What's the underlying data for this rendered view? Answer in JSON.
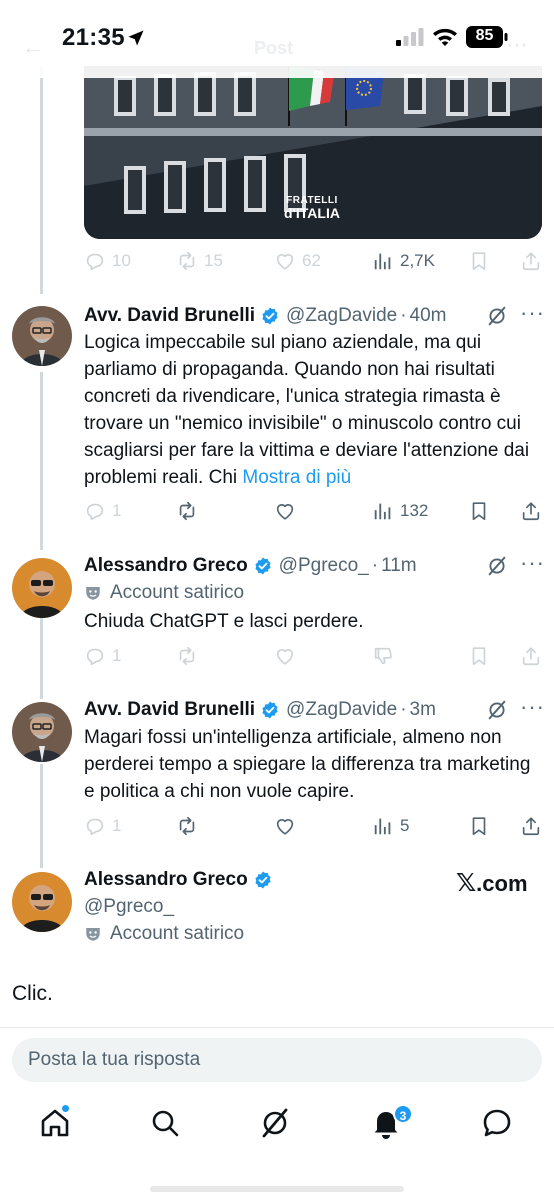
{
  "status_bar": {
    "time": "21:35",
    "battery": "85"
  },
  "header": {
    "title": "Post"
  },
  "media": {
    "logo_line1": "FRATELLI",
    "logo_line2": "d'ITALIA"
  },
  "top_stats": {
    "replies": "10",
    "reposts": "15",
    "likes": "62",
    "views": "2,7K"
  },
  "tweets": [
    {
      "name": "Avv. David Brunelli",
      "handle": "@ZagDavide",
      "sep": "·",
      "time": "40m",
      "text": "Logica impeccabile sul piano aziendale, ma qui parliamo di propaganda. Quando non hai risultati concreti da rivendicare, l'unica strategia rimasta è trovare un \"nemico invisibile\" o minuscolo contro cui scagliarsi per fare la vittima e deviare l'attenzione dai problemi reali. Chi ",
      "show_more": "Mostra di più",
      "replies": "1",
      "views": "132"
    },
    {
      "name": "Alessandro Greco",
      "handle": "@Pgreco_",
      "sep": "·",
      "time": "11m",
      "label": "Account satirico",
      "text": "Chiuda ChatGPT e lasci perdere.",
      "replies": "1"
    },
    {
      "name": "Avv. David Brunelli",
      "handle": "@ZagDavide",
      "sep": "·",
      "time": "3m",
      "text": "Magari fossi un'intelligenza artificiale, almeno non perderei tempo a spiegare la differenza tra marketing e politica a chi non vuole capire.",
      "replies": "1",
      "views": "5"
    },
    {
      "name": "Alessandro Greco",
      "handle": "@Pgreco_",
      "label": "Account satirico"
    }
  ],
  "watermark": {
    "x": "𝕏",
    "rest": ".com"
  },
  "caption": "Clic.",
  "reply": {
    "placeholder": "Posta la tua risposta"
  },
  "tabbar": {
    "notifications_badge": "3"
  },
  "colors": {
    "accent": "#1d9bf0",
    "text": "#0f1419",
    "muted": "#536471",
    "thread_line": "#cfd9de"
  },
  "icons": [
    "location-arrow-icon",
    "signal-icon",
    "wifi-icon",
    "battery-icon",
    "reply-icon",
    "repost-icon",
    "like-icon",
    "views-icon",
    "bookmark-icon",
    "share-icon",
    "verified-icon",
    "grok-icon",
    "more-icon",
    "satire-mask-icon",
    "home-icon",
    "search-icon",
    "notifications-icon",
    "messages-icon"
  ]
}
